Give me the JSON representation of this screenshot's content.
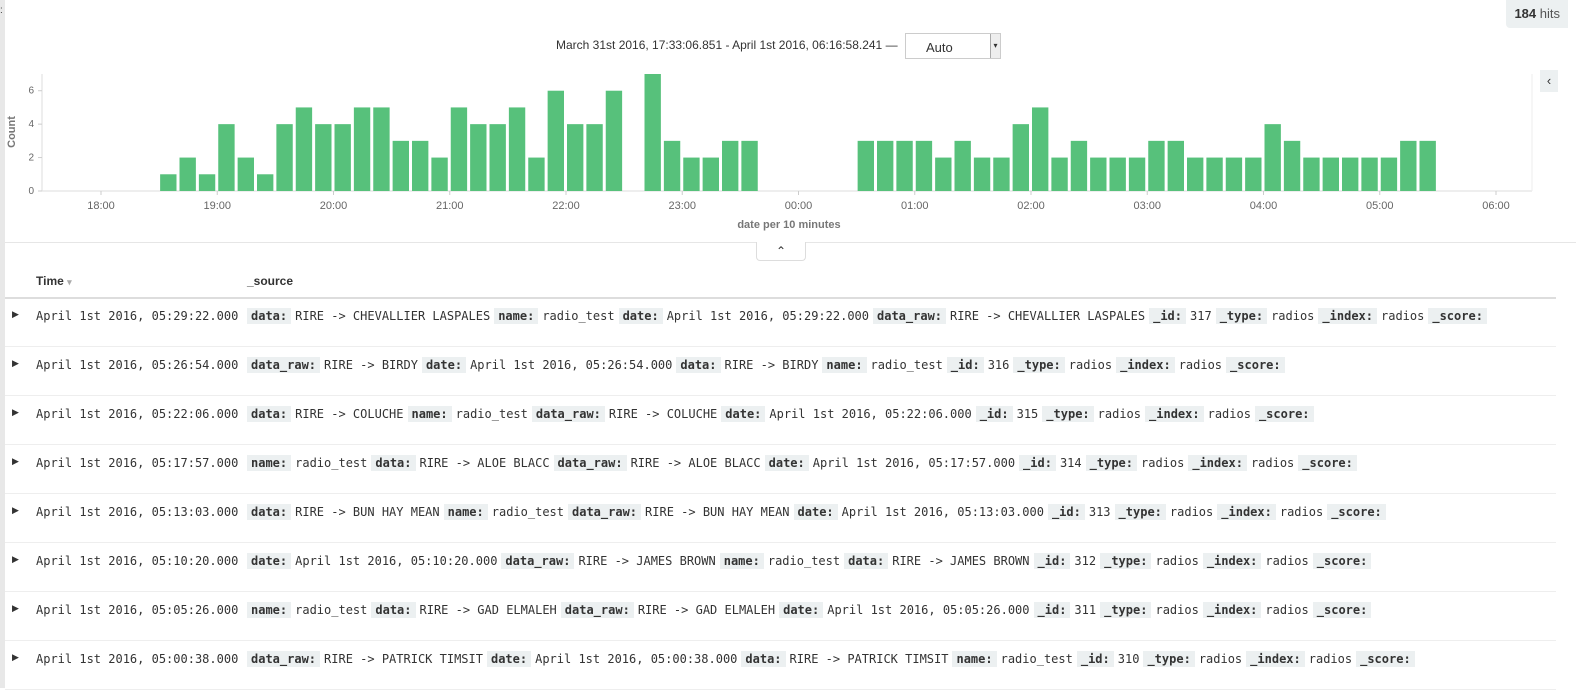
{
  "hits": {
    "count": "184",
    "label": "hits"
  },
  "header": {
    "time_range": "March 31st 2016, 17:33:06.851 - April 1st 2016, 06:16:58.241 —",
    "interval": "Auto"
  },
  "chart_data": {
    "type": "bar",
    "xlabel": "date per 10 minutes",
    "ylabel": "Count",
    "ylim": [
      0,
      7
    ],
    "yticks": [
      "0",
      "2",
      "4",
      "6"
    ],
    "xticks": [
      "18:00",
      "19:00",
      "20:00",
      "21:00",
      "22:00",
      "23:00",
      "00:00",
      "01:00",
      "02:00",
      "03:00",
      "04:00",
      "05:00",
      "06:00"
    ],
    "color": "#57c17b",
    "bars": [
      {
        "t": "18:30",
        "v": 1
      },
      {
        "t": "18:40",
        "v": 2
      },
      {
        "t": "18:50",
        "v": 1
      },
      {
        "t": "19:00",
        "v": 4
      },
      {
        "t": "19:10",
        "v": 2
      },
      {
        "t": "19:20",
        "v": 1
      },
      {
        "t": "19:30",
        "v": 4
      },
      {
        "t": "19:40",
        "v": 5
      },
      {
        "t": "19:50",
        "v": 4
      },
      {
        "t": "20:00",
        "v": 4
      },
      {
        "t": "20:10",
        "v": 5
      },
      {
        "t": "20:20",
        "v": 5
      },
      {
        "t": "20:30",
        "v": 3
      },
      {
        "t": "20:40",
        "v": 3
      },
      {
        "t": "20:50",
        "v": 2
      },
      {
        "t": "21:00",
        "v": 5
      },
      {
        "t": "21:10",
        "v": 4
      },
      {
        "t": "21:20",
        "v": 4
      },
      {
        "t": "21:30",
        "v": 5
      },
      {
        "t": "21:40",
        "v": 2
      },
      {
        "t": "21:50",
        "v": 6
      },
      {
        "t": "22:00",
        "v": 4
      },
      {
        "t": "22:10",
        "v": 4
      },
      {
        "t": "22:20",
        "v": 6
      },
      {
        "t": "22:40",
        "v": 7
      },
      {
        "t": "22:50",
        "v": 3
      },
      {
        "t": "23:00",
        "v": 2
      },
      {
        "t": "23:10",
        "v": 2
      },
      {
        "t": "23:20",
        "v": 3
      },
      {
        "t": "23:30",
        "v": 3
      },
      {
        "t": "00:30",
        "v": 3
      },
      {
        "t": "00:40",
        "v": 3
      },
      {
        "t": "00:50",
        "v": 3
      },
      {
        "t": "01:00",
        "v": 3
      },
      {
        "t": "01:10",
        "v": 2
      },
      {
        "t": "01:20",
        "v": 3
      },
      {
        "t": "01:30",
        "v": 2
      },
      {
        "t": "01:40",
        "v": 2
      },
      {
        "t": "01:50",
        "v": 4
      },
      {
        "t": "02:00",
        "v": 5
      },
      {
        "t": "02:10",
        "v": 2
      },
      {
        "t": "02:20",
        "v": 3
      },
      {
        "t": "02:30",
        "v": 2
      },
      {
        "t": "02:40",
        "v": 2
      },
      {
        "t": "02:50",
        "v": 2
      },
      {
        "t": "03:00",
        "v": 3
      },
      {
        "t": "03:10",
        "v": 3
      },
      {
        "t": "03:20",
        "v": 2
      },
      {
        "t": "03:30",
        "v": 2
      },
      {
        "t": "03:40",
        "v": 2
      },
      {
        "t": "03:50",
        "v": 2
      },
      {
        "t": "04:00",
        "v": 4
      },
      {
        "t": "04:10",
        "v": 3
      },
      {
        "t": "04:20",
        "v": 2
      },
      {
        "t": "04:30",
        "v": 2
      },
      {
        "t": "04:40",
        "v": 2
      },
      {
        "t": "04:50",
        "v": 2
      },
      {
        "t": "05:00",
        "v": 2
      },
      {
        "t": "05:10",
        "v": 3
      },
      {
        "t": "05:20",
        "v": 3
      }
    ]
  },
  "table": {
    "headers": {
      "time": "Time",
      "source": "_source"
    },
    "rows": [
      {
        "time": "April 1st 2016, 05:29:22.000",
        "fields": [
          [
            "data:",
            "RIRE -> CHEVALLIER LASPALES"
          ],
          [
            "name:",
            "radio_test"
          ],
          [
            "date:",
            "April 1st 2016, 05:29:22.000"
          ],
          [
            "data_raw:",
            "RIRE -> CHEVALLIER LASPALES"
          ],
          [
            "_id:",
            "317"
          ],
          [
            "_type:",
            "radios"
          ],
          [
            "_index:",
            "radios"
          ],
          [
            "_score:",
            ""
          ]
        ]
      },
      {
        "time": "April 1st 2016, 05:26:54.000",
        "fields": [
          [
            "data_raw:",
            "RIRE -> BIRDY"
          ],
          [
            "date:",
            "April 1st 2016, 05:26:54.000"
          ],
          [
            "data:",
            "RIRE -> BIRDY"
          ],
          [
            "name:",
            "radio_test"
          ],
          [
            "_id:",
            "316"
          ],
          [
            "_type:",
            "radios"
          ],
          [
            "_index:",
            "radios"
          ],
          [
            "_score:",
            ""
          ]
        ]
      },
      {
        "time": "April 1st 2016, 05:22:06.000",
        "fields": [
          [
            "data:",
            "RIRE -> COLUCHE"
          ],
          [
            "name:",
            "radio_test"
          ],
          [
            "data_raw:",
            "RIRE -> COLUCHE"
          ],
          [
            "date:",
            "April 1st 2016, 05:22:06.000"
          ],
          [
            "_id:",
            "315"
          ],
          [
            "_type:",
            "radios"
          ],
          [
            "_index:",
            "radios"
          ],
          [
            "_score:",
            ""
          ]
        ]
      },
      {
        "time": "April 1st 2016, 05:17:57.000",
        "fields": [
          [
            "name:",
            "radio_test"
          ],
          [
            "data:",
            "RIRE -> ALOE BLACC"
          ],
          [
            "data_raw:",
            "RIRE -> ALOE BLACC"
          ],
          [
            "date:",
            "April 1st 2016, 05:17:57.000"
          ],
          [
            "_id:",
            "314"
          ],
          [
            "_type:",
            "radios"
          ],
          [
            "_index:",
            "radios"
          ],
          [
            "_score:",
            ""
          ]
        ]
      },
      {
        "time": "April 1st 2016, 05:13:03.000",
        "fields": [
          [
            "data:",
            "RIRE -> BUN HAY MEAN"
          ],
          [
            "name:",
            "radio_test"
          ],
          [
            "data_raw:",
            "RIRE -> BUN HAY MEAN"
          ],
          [
            "date:",
            "April 1st 2016, 05:13:03.000"
          ],
          [
            "_id:",
            "313"
          ],
          [
            "_type:",
            "radios"
          ],
          [
            "_index:",
            "radios"
          ],
          [
            "_score:",
            ""
          ]
        ]
      },
      {
        "time": "April 1st 2016, 05:10:20.000",
        "fields": [
          [
            "date:",
            "April 1st 2016, 05:10:20.000"
          ],
          [
            "data_raw:",
            "RIRE -> JAMES BROWN"
          ],
          [
            "name:",
            "radio_test"
          ],
          [
            "data:",
            "RIRE -> JAMES BROWN"
          ],
          [
            "_id:",
            "312"
          ],
          [
            "_type:",
            "radios"
          ],
          [
            "_index:",
            "radios"
          ],
          [
            "_score:",
            ""
          ]
        ]
      },
      {
        "time": "April 1st 2016, 05:05:26.000",
        "fields": [
          [
            "name:",
            "radio_test"
          ],
          [
            "data:",
            "RIRE -> GAD ELMALEH"
          ],
          [
            "data_raw:",
            "RIRE -> GAD ELMALEH"
          ],
          [
            "date:",
            "April 1st 2016, 05:05:26.000"
          ],
          [
            "_id:",
            "311"
          ],
          [
            "_type:",
            "radios"
          ],
          [
            "_index:",
            "radios"
          ],
          [
            "_score:",
            ""
          ]
        ]
      },
      {
        "time": "April 1st 2016, 05:00:38.000",
        "fields": [
          [
            "data_raw:",
            "RIRE -> PATRICK TIMSIT"
          ],
          [
            "date:",
            "April 1st 2016, 05:00:38.000"
          ],
          [
            "data:",
            "RIRE -> PATRICK TIMSIT"
          ],
          [
            "name:",
            "radio_test"
          ],
          [
            "_id:",
            "310"
          ],
          [
            "_type:",
            "radios"
          ],
          [
            "_index:",
            "radios"
          ],
          [
            "_score:",
            ""
          ]
        ]
      }
    ]
  }
}
